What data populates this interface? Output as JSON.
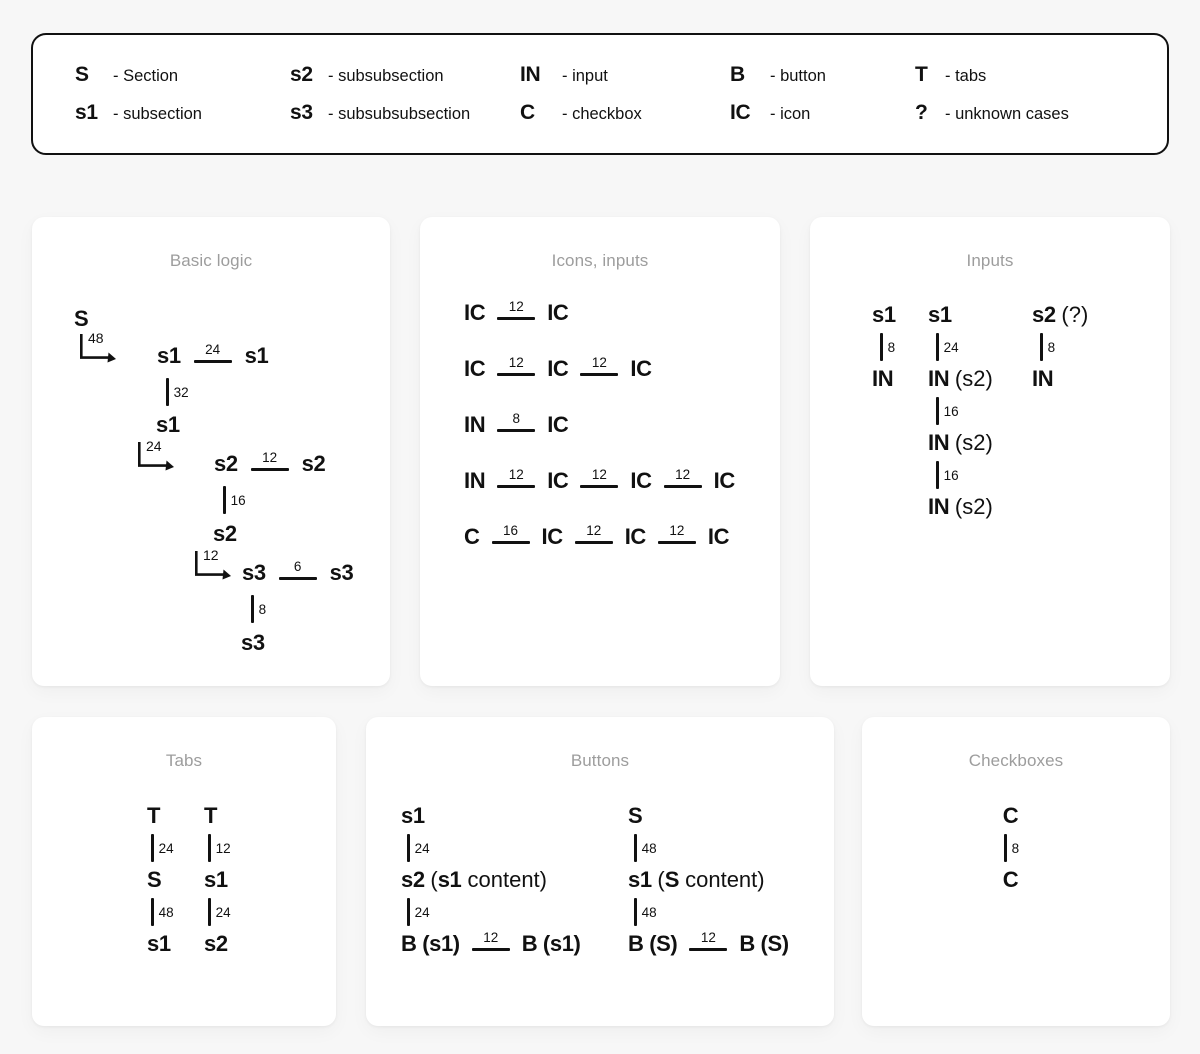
{
  "legend": {
    "columns": [
      {
        "entries": [
          {
            "code": "S",
            "desc": "- Section"
          },
          {
            "code": "s1",
            "desc": "- subsection"
          }
        ]
      },
      {
        "entries": [
          {
            "code": "s2",
            "desc": "- subsubsection"
          },
          {
            "code": "s3",
            "desc": "- subsubsubsection"
          }
        ]
      },
      {
        "entries": [
          {
            "code": "IN",
            "desc": "- input"
          },
          {
            "code": "C",
            "desc": "- checkbox"
          }
        ]
      },
      {
        "entries": [
          {
            "code": "B",
            "desc": "- button"
          },
          {
            "code": "IC",
            "desc": "- icon"
          }
        ]
      },
      {
        "entries": [
          {
            "code": "T",
            "desc": "- tabs"
          },
          {
            "code": "?",
            "desc": "- unknown cases"
          }
        ]
      }
    ]
  },
  "cards": {
    "basic": {
      "title": "Basic logic",
      "nodes": {
        "s_root": "S",
        "s1_a": "s1",
        "s1_b": "s1",
        "s1_c": "s1",
        "s2_a": "s2",
        "s2_b": "s2",
        "s2_c": "s2",
        "s3_a": "s3",
        "s3_b": "s3",
        "s3_c": "s3"
      },
      "elbows": {
        "e1": "48",
        "e2": "24",
        "e3": "12"
      },
      "vbars": {
        "v1": "32",
        "v2": "16",
        "v3": "8"
      },
      "hrules": {
        "h1": "24",
        "h2": "12",
        "h3": "6"
      }
    },
    "icons": {
      "title": "Icons, inputs",
      "rows": [
        {
          "items": [
            "IC",
            "IC"
          ],
          "gaps": [
            "12"
          ]
        },
        {
          "items": [
            "IC",
            "IC",
            "IC"
          ],
          "gaps": [
            "12",
            "12"
          ]
        },
        {
          "items": [
            "IN",
            "IC"
          ],
          "gaps": [
            "8"
          ]
        },
        {
          "items": [
            "IN",
            "IC",
            "IC",
            "IC"
          ],
          "gaps": [
            "12",
            "12",
            "12"
          ]
        },
        {
          "items": [
            "C",
            "IC",
            "IC",
            "IC"
          ],
          "gaps": [
            "16",
            "12",
            "12"
          ]
        }
      ]
    },
    "inputs": {
      "title": "Inputs",
      "columns": [
        {
          "steps": [
            {
              "type": "node",
              "label": "s1"
            },
            {
              "type": "gap",
              "value": "8"
            },
            {
              "type": "node",
              "label": "IN"
            }
          ]
        },
        {
          "steps": [
            {
              "type": "node",
              "label": "s1"
            },
            {
              "type": "gap",
              "value": "24"
            },
            {
              "type": "node",
              "label": "IN",
              "paren": "(s2)"
            },
            {
              "type": "gap",
              "value": "16"
            },
            {
              "type": "node",
              "label": "IN",
              "paren": "(s2)"
            },
            {
              "type": "gap",
              "value": "16"
            },
            {
              "type": "node",
              "label": "IN",
              "paren": "(s2)"
            }
          ]
        },
        {
          "steps": [
            {
              "type": "node",
              "label": "s2",
              "paren": "(?)"
            },
            {
              "type": "gap",
              "value": "8"
            },
            {
              "type": "node",
              "label": "IN"
            }
          ]
        }
      ]
    },
    "tabs": {
      "title": "Tabs",
      "columns": [
        {
          "steps": [
            {
              "type": "node",
              "label": "T"
            },
            {
              "type": "gap",
              "value": "24"
            },
            {
              "type": "node",
              "label": "S"
            },
            {
              "type": "gap",
              "value": "48"
            },
            {
              "type": "node",
              "label": "s1"
            }
          ]
        },
        {
          "steps": [
            {
              "type": "node",
              "label": "T"
            },
            {
              "type": "gap",
              "value": "12"
            },
            {
              "type": "node",
              "label": "s1"
            },
            {
              "type": "gap",
              "value": "24"
            },
            {
              "type": "node",
              "label": "s2"
            }
          ]
        }
      ]
    },
    "buttons": {
      "title": "Buttons",
      "columns": [
        {
          "steps": [
            {
              "type": "node",
              "label": "s1"
            },
            {
              "type": "gap",
              "value": "24"
            },
            {
              "type": "node",
              "label": "s2",
              "paren_open": "(",
              "paren_bold": "s1",
              "paren_rest": " content)"
            },
            {
              "type": "gap",
              "value": "24"
            }
          ],
          "pair": {
            "left": "B (s1)",
            "gap": "12",
            "right": "B (s1)"
          }
        },
        {
          "steps": [
            {
              "type": "node",
              "label": "S"
            },
            {
              "type": "gap",
              "value": "48"
            },
            {
              "type": "node",
              "label": "s1",
              "paren_open": "(",
              "paren_bold": "S",
              "paren_rest": " content)"
            },
            {
              "type": "gap",
              "value": "48"
            }
          ],
          "pair": {
            "left": "B (S)",
            "gap": "12",
            "right": "B (S)"
          }
        }
      ]
    },
    "checkboxes": {
      "title": "Checkboxes",
      "columns": [
        {
          "steps": [
            {
              "type": "node",
              "label": "C"
            },
            {
              "type": "gap",
              "value": "8"
            },
            {
              "type": "node",
              "label": "C"
            }
          ]
        }
      ]
    }
  },
  "colors": {
    "page_background": "#f7f7f7",
    "card_background": "#ffffff",
    "ink": "#111111",
    "title_gray": "#9d9d9d",
    "legend_border": "#111111"
  }
}
